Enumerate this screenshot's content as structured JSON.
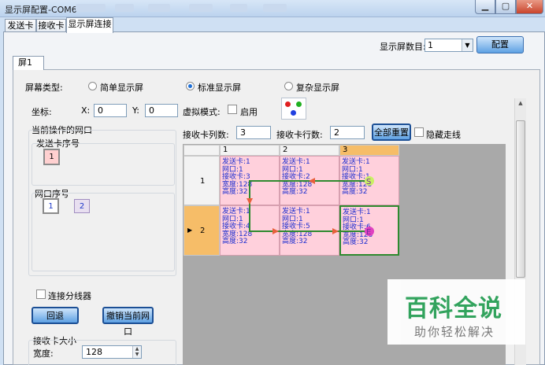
{
  "window": {
    "title": "显示屏配置-COM6",
    "minimize_icon": "minimize-icon",
    "maximize_icon": "maximize-icon",
    "close_icon": "close-icon"
  },
  "tabs": [
    "发送卡",
    "接收卡",
    "显示屏连接"
  ],
  "screen_count": {
    "label": "显示屏数目:",
    "value": "1",
    "config_button": "配置"
  },
  "inner_tab": "屏1",
  "screen_type": {
    "label": "屏幕类型:",
    "options": [
      "简单显示屏",
      "标准显示屏",
      "复杂显示屏"
    ],
    "selected": "标准显示屏"
  },
  "coords": {
    "label": "坐标:",
    "x_label": "X:",
    "x_value": "0",
    "y_label": "Y:",
    "y_value": "0"
  },
  "virtual_mode": {
    "label": "虚拟模式:",
    "checkbox_label": "启用",
    "checked": false
  },
  "current_port": {
    "title": "当前操作的网口",
    "sender_title": "发送卡序号",
    "sender_value": "1",
    "port_title": "网口序号",
    "ports": [
      "1",
      "2"
    ]
  },
  "splitter": {
    "label": "连接分线器",
    "checked": false
  },
  "buttons": {
    "back": "回退",
    "undo_port": "撤销当前网口",
    "reset_all": "全部重置"
  },
  "receiver_size": {
    "title": "接收卡大小",
    "width_label": "宽度:",
    "width_value": "128"
  },
  "grid_controls": {
    "cols_label": "接收卡列数:",
    "cols_value": "3",
    "rows_label": "接收卡行数:",
    "rows_value": "2",
    "hide_path_label": "隐藏走线"
  },
  "grid": {
    "columns": [
      "1",
      "2",
      "3"
    ],
    "rows": [
      "1",
      "2"
    ],
    "selected_column": "3",
    "selected_row": "2",
    "cells": [
      [
        {
          "lines": [
            "发送卡:1",
            "网口:1",
            "接收卡:3",
            "宽度:128",
            "高度:32"
          ]
        },
        {
          "lines": [
            "发送卡:1",
            "网口:1",
            "接收卡:2",
            "宽度:128",
            "高度:32"
          ]
        },
        {
          "lines": [
            "发送卡:1",
            "网口:1",
            "接收卡:1",
            "宽度:128",
            "高度:32"
          ],
          "marker": "S"
        }
      ],
      [
        {
          "lines": [
            "发送卡:1",
            "网口:1",
            "接收卡:4",
            "宽度:128",
            "高度:32"
          ]
        },
        {
          "lines": [
            "发送卡:1",
            "网口:1",
            "接收卡:5",
            "宽度:128",
            "高度:32"
          ]
        },
        {
          "lines": [
            "发送卡:1",
            "网口:1",
            "接收卡:6",
            "宽度:128",
            "高度:32"
          ],
          "marker": "E"
        }
      ]
    ]
  },
  "watermark": {
    "title": "百科全说",
    "subtitle": "助你轻松解决"
  },
  "colors": {
    "accent": "#3a86d6",
    "cell_bg": "#ffd0dc",
    "selected_header": "#f6bd68",
    "path": "#2f8a2f",
    "path_arrow": "#e8603c"
  }
}
